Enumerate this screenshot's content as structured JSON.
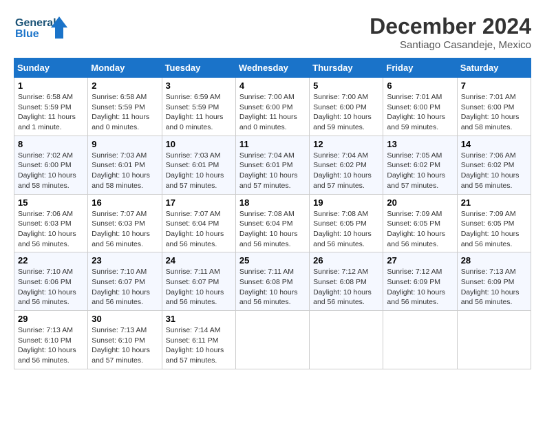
{
  "header": {
    "logo_line1": "General",
    "logo_line2": "Blue",
    "month_year": "December 2024",
    "location": "Santiago Casandeje, Mexico"
  },
  "days_of_week": [
    "Sunday",
    "Monday",
    "Tuesday",
    "Wednesday",
    "Thursday",
    "Friday",
    "Saturday"
  ],
  "weeks": [
    [
      {
        "day": "1",
        "info": "Sunrise: 6:58 AM\nSunset: 5:59 PM\nDaylight: 11 hours\nand 1 minute."
      },
      {
        "day": "2",
        "info": "Sunrise: 6:58 AM\nSunset: 5:59 PM\nDaylight: 11 hours\nand 0 minutes."
      },
      {
        "day": "3",
        "info": "Sunrise: 6:59 AM\nSunset: 5:59 PM\nDaylight: 11 hours\nand 0 minutes."
      },
      {
        "day": "4",
        "info": "Sunrise: 7:00 AM\nSunset: 6:00 PM\nDaylight: 11 hours\nand 0 minutes."
      },
      {
        "day": "5",
        "info": "Sunrise: 7:00 AM\nSunset: 6:00 PM\nDaylight: 10 hours\nand 59 minutes."
      },
      {
        "day": "6",
        "info": "Sunrise: 7:01 AM\nSunset: 6:00 PM\nDaylight: 10 hours\nand 59 minutes."
      },
      {
        "day": "7",
        "info": "Sunrise: 7:01 AM\nSunset: 6:00 PM\nDaylight: 10 hours\nand 58 minutes."
      }
    ],
    [
      {
        "day": "8",
        "info": "Sunrise: 7:02 AM\nSunset: 6:00 PM\nDaylight: 10 hours\nand 58 minutes."
      },
      {
        "day": "9",
        "info": "Sunrise: 7:03 AM\nSunset: 6:01 PM\nDaylight: 10 hours\nand 58 minutes."
      },
      {
        "day": "10",
        "info": "Sunrise: 7:03 AM\nSunset: 6:01 PM\nDaylight: 10 hours\nand 57 minutes."
      },
      {
        "day": "11",
        "info": "Sunrise: 7:04 AM\nSunset: 6:01 PM\nDaylight: 10 hours\nand 57 minutes."
      },
      {
        "day": "12",
        "info": "Sunrise: 7:04 AM\nSunset: 6:02 PM\nDaylight: 10 hours\nand 57 minutes."
      },
      {
        "day": "13",
        "info": "Sunrise: 7:05 AM\nSunset: 6:02 PM\nDaylight: 10 hours\nand 57 minutes."
      },
      {
        "day": "14",
        "info": "Sunrise: 7:06 AM\nSunset: 6:02 PM\nDaylight: 10 hours\nand 56 minutes."
      }
    ],
    [
      {
        "day": "15",
        "info": "Sunrise: 7:06 AM\nSunset: 6:03 PM\nDaylight: 10 hours\nand 56 minutes."
      },
      {
        "day": "16",
        "info": "Sunrise: 7:07 AM\nSunset: 6:03 PM\nDaylight: 10 hours\nand 56 minutes."
      },
      {
        "day": "17",
        "info": "Sunrise: 7:07 AM\nSunset: 6:04 PM\nDaylight: 10 hours\nand 56 minutes."
      },
      {
        "day": "18",
        "info": "Sunrise: 7:08 AM\nSunset: 6:04 PM\nDaylight: 10 hours\nand 56 minutes."
      },
      {
        "day": "19",
        "info": "Sunrise: 7:08 AM\nSunset: 6:05 PM\nDaylight: 10 hours\nand 56 minutes."
      },
      {
        "day": "20",
        "info": "Sunrise: 7:09 AM\nSunset: 6:05 PM\nDaylight: 10 hours\nand 56 minutes."
      },
      {
        "day": "21",
        "info": "Sunrise: 7:09 AM\nSunset: 6:05 PM\nDaylight: 10 hours\nand 56 minutes."
      }
    ],
    [
      {
        "day": "22",
        "info": "Sunrise: 7:10 AM\nSunset: 6:06 PM\nDaylight: 10 hours\nand 56 minutes."
      },
      {
        "day": "23",
        "info": "Sunrise: 7:10 AM\nSunset: 6:07 PM\nDaylight: 10 hours\nand 56 minutes."
      },
      {
        "day": "24",
        "info": "Sunrise: 7:11 AM\nSunset: 6:07 PM\nDaylight: 10 hours\nand 56 minutes."
      },
      {
        "day": "25",
        "info": "Sunrise: 7:11 AM\nSunset: 6:08 PM\nDaylight: 10 hours\nand 56 minutes."
      },
      {
        "day": "26",
        "info": "Sunrise: 7:12 AM\nSunset: 6:08 PM\nDaylight: 10 hours\nand 56 minutes."
      },
      {
        "day": "27",
        "info": "Sunrise: 7:12 AM\nSunset: 6:09 PM\nDaylight: 10 hours\nand 56 minutes."
      },
      {
        "day": "28",
        "info": "Sunrise: 7:13 AM\nSunset: 6:09 PM\nDaylight: 10 hours\nand 56 minutes."
      }
    ],
    [
      {
        "day": "29",
        "info": "Sunrise: 7:13 AM\nSunset: 6:10 PM\nDaylight: 10 hours\nand 56 minutes."
      },
      {
        "day": "30",
        "info": "Sunrise: 7:13 AM\nSunset: 6:10 PM\nDaylight: 10 hours\nand 57 minutes."
      },
      {
        "day": "31",
        "info": "Sunrise: 7:14 AM\nSunset: 6:11 PM\nDaylight: 10 hours\nand 57 minutes."
      },
      null,
      null,
      null,
      null
    ]
  ]
}
